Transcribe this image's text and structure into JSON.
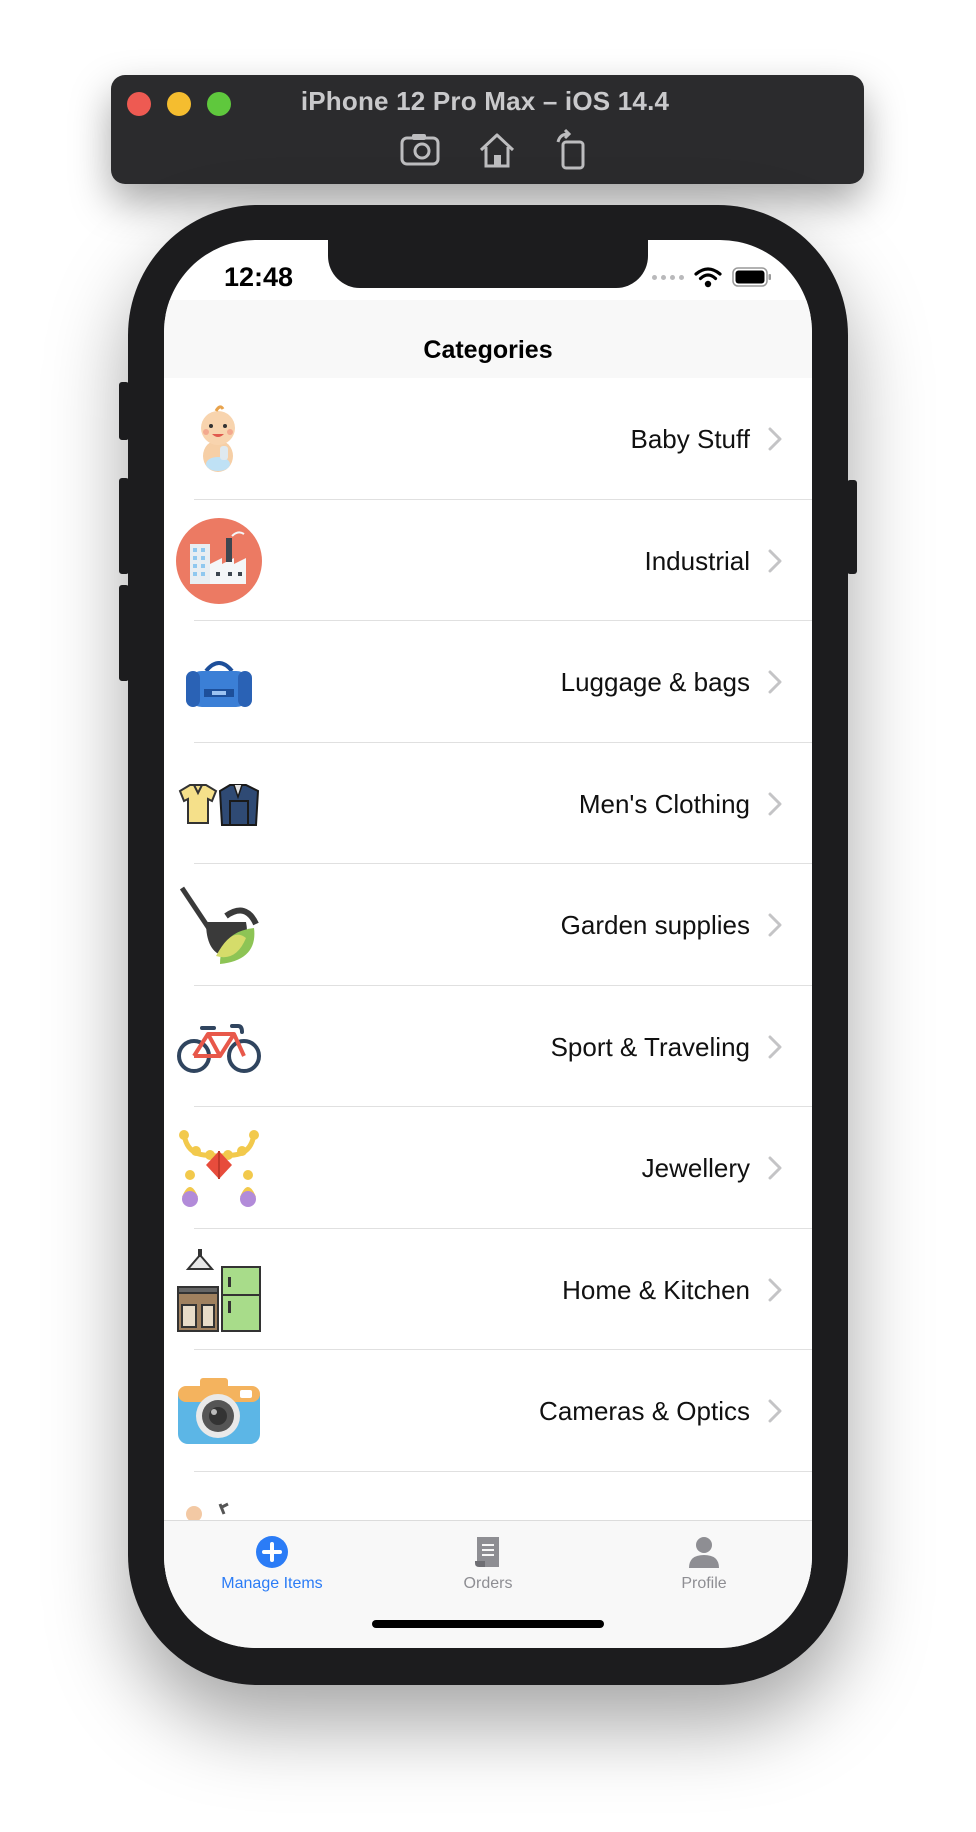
{
  "simulator": {
    "title": "iPhone 12 Pro Max – iOS 14.4",
    "tools": [
      "screenshot-icon",
      "home-icon",
      "rotate-icon"
    ]
  },
  "status_bar": {
    "time": "12:48"
  },
  "nav": {
    "title": "Categories"
  },
  "categories": [
    {
      "label": "Baby Stuff",
      "icon": "baby-icon"
    },
    {
      "label": "Industrial",
      "icon": "factory-icon"
    },
    {
      "label": "Luggage & bags",
      "icon": "duffel-bag-icon"
    },
    {
      "label": "Men's Clothing",
      "icon": "shirt-jacket-icon"
    },
    {
      "label": "Garden supplies",
      "icon": "watering-can-icon"
    },
    {
      "label": "Sport & Traveling",
      "icon": "bicycle-icon"
    },
    {
      "label": "Jewellery",
      "icon": "necklace-icon"
    },
    {
      "label": "Home & Kitchen",
      "icon": "kitchen-icon"
    },
    {
      "label": "Cameras & Optics",
      "icon": "camera-icon"
    }
  ],
  "tabs": [
    {
      "label": "Manage Items",
      "icon": "plus-circle-icon",
      "active": true
    },
    {
      "label": "Orders",
      "icon": "document-icon",
      "active": false
    },
    {
      "label": "Profile",
      "icon": "person-icon",
      "active": false
    }
  ],
  "colors": {
    "accent": "#2b7cf6",
    "tab_inactive": "#8e8e93"
  }
}
